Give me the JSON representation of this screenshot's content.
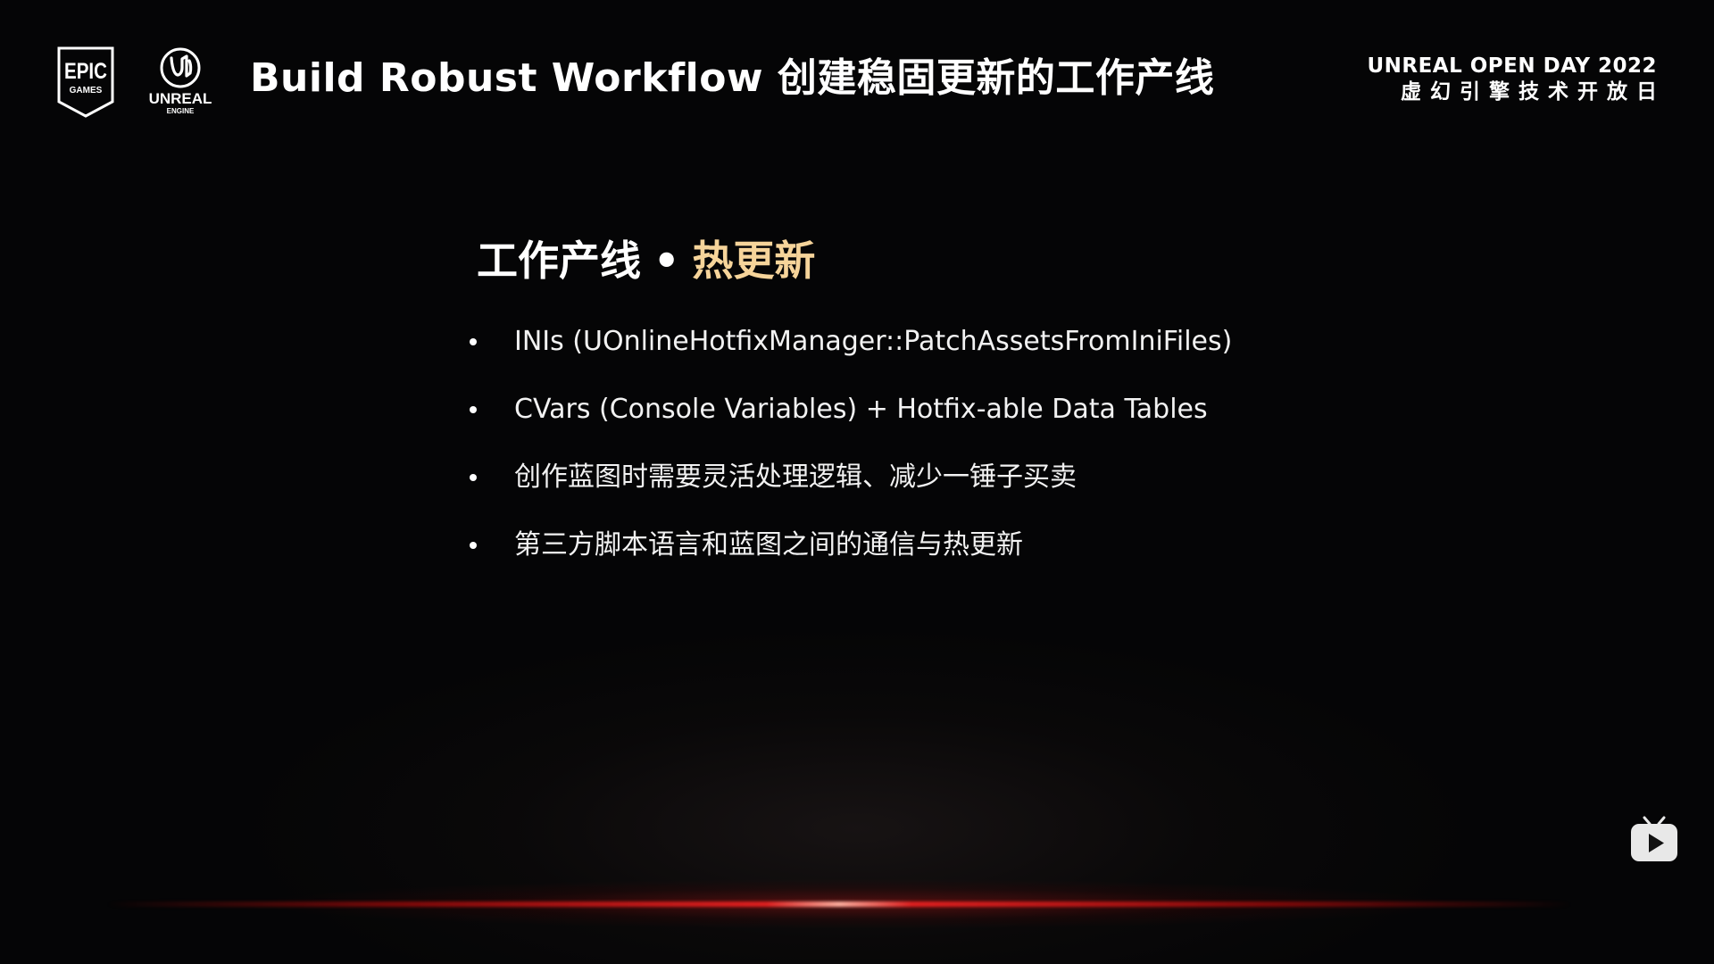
{
  "header": {
    "title": "Build Robust Workflow 创建稳固更新的工作产线",
    "event_name_en": "UNREAL OPEN DAY 2022",
    "event_name_cn": "虚幻引擎技术开放日",
    "epic_logo_text_top": "EPIC",
    "epic_logo_text_bottom": "GAMES",
    "ue_logo_text": "UNREAL",
    "ue_logo_subtext": "ENGINE"
  },
  "section": {
    "heading_main": "工作产线",
    "heading_separator": "•",
    "heading_accent": "热更新",
    "accent_color": "#f6d49a"
  },
  "bullets": [
    "INIs (UOnlineHotfixManager::PatchAssetsFromIniFiles)",
    "CVars (Console Variables) + Hotfix-able Data Tables",
    "创作蓝图时需要灵活处理逻辑、减少一锤子买卖",
    "第三方脚本语言和蓝图之间的通信与热更新"
  ],
  "icons": {
    "video_watermark": "tv-play-icon"
  }
}
